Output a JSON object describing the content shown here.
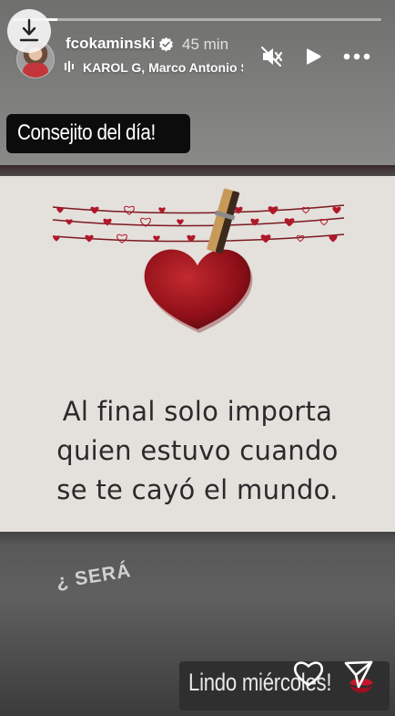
{
  "story": {
    "progress_fraction": 0.12,
    "username": "fcokaminski",
    "verified": true,
    "time_ago": "45 min",
    "music_text": "KAROL G, Marco Antonio Solís",
    "caption_top": "Consejito del día!",
    "quote_lines": [
      "Al final solo importa",
      "quien estuvo cuando",
      "se te cayó el mundo."
    ],
    "sticker_text": "¿ SERÁ",
    "bottom_text": "Lindo miércoles!"
  },
  "icons": {
    "download": "download-icon",
    "verified": "verified-badge-icon",
    "music": "music-bars-icon",
    "mute": "speaker-muted-icon",
    "play": "play-icon",
    "more": "more-horizontal-icon",
    "like": "heart-outline-icon",
    "share": "send-icon",
    "kiss": "kiss-lips-icon"
  },
  "colors": {
    "progress_fill": "#ffffff",
    "heart": "#a6141c",
    "caption_bg": "#0c0c0c"
  }
}
